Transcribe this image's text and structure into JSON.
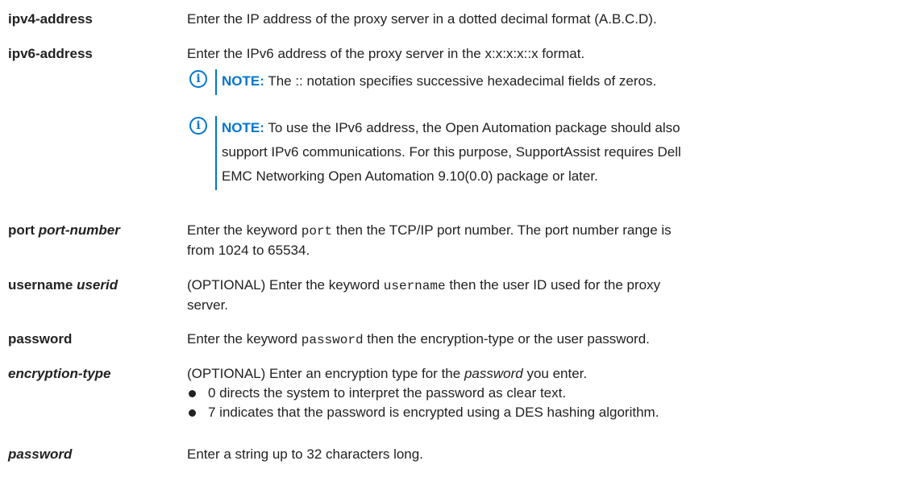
{
  "colors": {
    "accent": "#0076ce",
    "text": "#222222",
    "background": "#ffffff"
  },
  "icons": {
    "note": "info-icon"
  },
  "rows": {
    "ipv4": {
      "term": "ipv4-address",
      "desc": "Enter the IP address of the proxy server in a dotted decimal format (A.B.C.D)."
    },
    "ipv6": {
      "term": "ipv6-address",
      "desc": "Enter the IPv6 address of the proxy server in the x:x:x:x::x format.",
      "note1": {
        "label": "NOTE:",
        "text": "The :: notation specifies successive hexadecimal fields of zeros."
      },
      "note2": {
        "label": "NOTE:",
        "line1": "To use the IPv6 address, the Open Automation package should also",
        "line2": "support IPv6 communications. For this purpose, SupportAssist requires Dell",
        "line3": "EMC Networking Open Automation 9.10(0.0) package or later."
      }
    },
    "port": {
      "term_keyword": "port",
      "term_arg": "port-number",
      "desc_pre": "Enter the keyword",
      "desc_code": "port",
      "desc_post": "then the TCP/IP port number. The port number range is",
      "desc_line2": "from 1024 to 65534."
    },
    "username": {
      "term_keyword": "username",
      "term_arg": "userid",
      "desc_pre": "(OPTIONAL) Enter the keyword",
      "desc_code": "username",
      "desc_post": "then the user ID used for the proxy",
      "desc_line2": "server."
    },
    "password": {
      "term": "password",
      "desc_pre": "Enter the keyword",
      "desc_code": "password",
      "desc_post": "then the encryption-type or the user password."
    },
    "encryption": {
      "term": "encryption-type",
      "desc_pre": "(OPTIONAL) Enter an encryption type for the",
      "desc_em": "password",
      "desc_post": "you enter.",
      "bullets": [
        "0 directs the system to interpret the password as clear text.",
        "7 indicates that the password is encrypted using a DES hashing algorithm."
      ]
    },
    "password_arg": {
      "term": "password",
      "desc": "Enter a string up to 32 characters long."
    }
  }
}
